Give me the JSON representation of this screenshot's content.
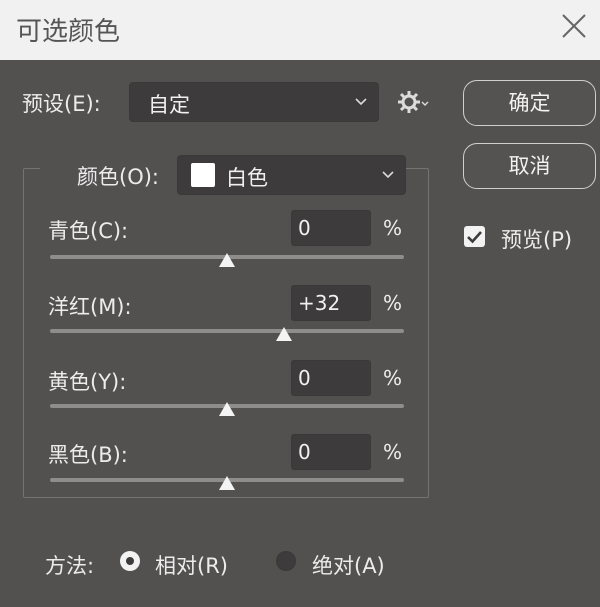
{
  "window": {
    "title": "可选颜色",
    "close_icon": "close-icon"
  },
  "preset": {
    "label": "预设(E):",
    "value": "自定"
  },
  "buttons": {
    "ok": "确定",
    "cancel": "取消"
  },
  "preview": {
    "label": "预览(P)",
    "checked": true
  },
  "colors": {
    "label": "颜色(O):",
    "value": "白色",
    "swatch_color": "#ffffff"
  },
  "sliders": [
    {
      "label": "青色(C):",
      "value": "0",
      "unit": "%",
      "level": 0
    },
    {
      "label": "洋红(M):",
      "value": "+32",
      "unit": "%",
      "level": 32
    },
    {
      "label": "黄色(Y):",
      "value": "0",
      "unit": "%",
      "level": 0
    },
    {
      "label": "黑色(B):",
      "value": "0",
      "unit": "%",
      "level": 0
    }
  ],
  "method": {
    "label": "方法:",
    "options": [
      {
        "label": "相对(R)",
        "selected": true
      },
      {
        "label": "绝对(A)",
        "selected": false
      }
    ]
  }
}
